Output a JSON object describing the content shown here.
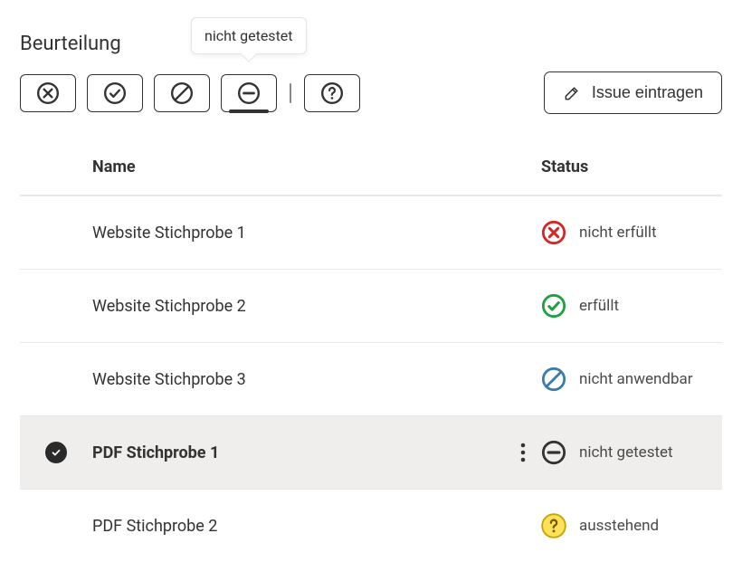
{
  "section_title": "Beurteilung",
  "tooltip": "nicht getestet",
  "toolbar_buttons": [
    {
      "name": "rating-not-fulfilled",
      "selected": false
    },
    {
      "name": "rating-fulfilled",
      "selected": false
    },
    {
      "name": "rating-not-applicable",
      "selected": false
    },
    {
      "name": "rating-not-tested",
      "selected": true
    },
    {
      "name": "rating-help",
      "selected": false
    }
  ],
  "issue_button": "Issue eintragen",
  "table": {
    "headers": {
      "name": "Name",
      "status": "Status"
    },
    "rows": [
      {
        "name": "Website Stichprobe 1",
        "status_label": "nicht erfüllt",
        "status_kind": "not-fulfilled",
        "selected": false
      },
      {
        "name": "Website Stichprobe 2",
        "status_label": "erfüllt",
        "status_kind": "fulfilled",
        "selected": false
      },
      {
        "name": "Website Stichprobe 3",
        "status_label": "nicht anwendbar",
        "status_kind": "not-applicable",
        "selected": false
      },
      {
        "name": "PDF Stichprobe 1",
        "status_label": "nicht getestet",
        "status_kind": "not-tested",
        "selected": true
      },
      {
        "name": "PDF Stichprobe 2",
        "status_label": "ausstehend",
        "status_kind": "pending",
        "selected": false
      }
    ]
  }
}
